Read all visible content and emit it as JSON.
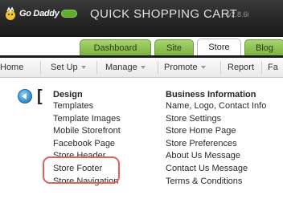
{
  "header": {
    "brand": "Go Daddy",
    "title": "QUICK SHOPPING CART",
    "version": "v2.8.6i"
  },
  "tabs": [
    {
      "label": "Dashboard",
      "active": false
    },
    {
      "label": "Site",
      "active": false
    },
    {
      "label": "Store",
      "active": true
    },
    {
      "label": "Blog",
      "active": false
    }
  ],
  "menu": [
    {
      "label": "Home",
      "dropdown": false
    },
    {
      "label": "Set Up",
      "dropdown": true
    },
    {
      "label": "Manage",
      "dropdown": true
    },
    {
      "label": "Promote",
      "dropdown": true
    },
    {
      "label": "Report",
      "dropdown": false
    },
    {
      "label": "Fa",
      "dropdown": false
    }
  ],
  "page": {
    "title": "["
  },
  "design": {
    "heading": "Design",
    "links": [
      "Templates",
      "Template Images",
      "Mobile Storefront",
      "Facebook Page",
      "Store Header",
      "Store Footer",
      "Store Navigation"
    ]
  },
  "business": {
    "heading": "Business Information",
    "links": [
      "Name, Logo, Contact Info",
      "Store Settings",
      "Store Home Page",
      "Store Preferences",
      "About Us Message",
      "Contact Us Message",
      "Terms & Conditions"
    ]
  },
  "colors": {
    "tab_green": "#8cc152",
    "highlight": "#e0605a"
  }
}
